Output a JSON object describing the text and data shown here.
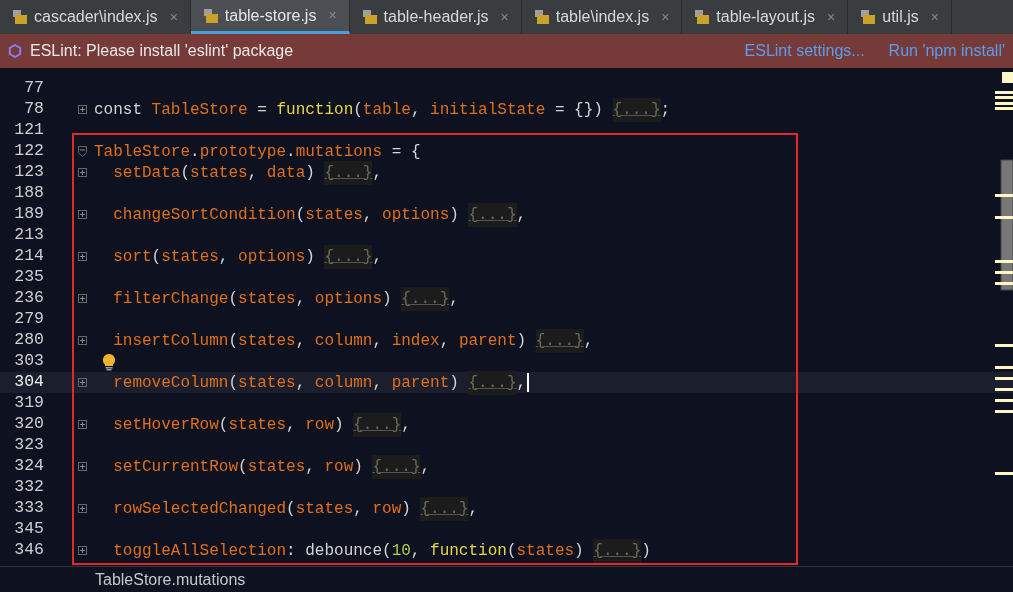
{
  "tabs": [
    {
      "label": "cascader\\index.js",
      "selected": false
    },
    {
      "label": "table-store.js",
      "selected": true
    },
    {
      "label": "table-header.js",
      "selected": false
    },
    {
      "label": "table\\index.js",
      "selected": false
    },
    {
      "label": "table-layout.js",
      "selected": false
    },
    {
      "label": "util.js",
      "selected": false
    }
  ],
  "tab_close": "×",
  "notification": {
    "message": "ESLint: Please install 'eslint' package",
    "actions": [
      "ESLint settings...",
      "Run 'npm install'"
    ]
  },
  "editor": {
    "lines": [
      {
        "number": "77",
        "kind": "none",
        "current": false
      },
      {
        "number": "78",
        "kind": "expand",
        "current": false,
        "tokens": [
          {
            "kind": "plain",
            "text": "const "
          },
          {
            "kind": "name",
            "text": "TableStore"
          },
          {
            "kind": "plain",
            "text": " = "
          },
          {
            "kind": "keyword",
            "text": "function"
          },
          {
            "kind": "plain",
            "text": "("
          },
          {
            "kind": "name",
            "text": "table"
          },
          {
            "kind": "plain",
            "text": ", "
          },
          {
            "kind": "name",
            "text": "initialState"
          },
          {
            "kind": "plain",
            "text": " = {}) "
          },
          {
            "kind": "folded",
            "text": "{...}"
          },
          {
            "kind": "plain",
            "text": ";"
          }
        ]
      },
      {
        "number": "121",
        "kind": "none",
        "current": false
      },
      {
        "number": "122",
        "kind": "collapse",
        "current": false,
        "tokens": [
          {
            "kind": "name",
            "text": "TableStore"
          },
          {
            "kind": "plain",
            "text": "."
          },
          {
            "kind": "name",
            "text": "prototype"
          },
          {
            "kind": "plain",
            "text": "."
          },
          {
            "kind": "name",
            "text": "mutations"
          },
          {
            "kind": "plain",
            "text": " = {"
          }
        ]
      },
      {
        "number": "123",
        "kind": "expand",
        "current": false,
        "tokens": [
          {
            "kind": "name",
            "text": "  setData"
          },
          {
            "kind": "plain",
            "text": "("
          },
          {
            "kind": "name",
            "text": "states"
          },
          {
            "kind": "plain",
            "text": ", "
          },
          {
            "kind": "name",
            "text": "data"
          },
          {
            "kind": "plain",
            "text": ") "
          },
          {
            "kind": "folded",
            "text": "{...}"
          },
          {
            "kind": "plain",
            "text": ","
          }
        ]
      },
      {
        "number": "188",
        "kind": "none",
        "current": false
      },
      {
        "number": "189",
        "kind": "expand",
        "current": false,
        "tokens": [
          {
            "kind": "name",
            "text": "  changeSortCondition"
          },
          {
            "kind": "plain",
            "text": "("
          },
          {
            "kind": "name",
            "text": "states"
          },
          {
            "kind": "plain",
            "text": ", "
          },
          {
            "kind": "name",
            "text": "options"
          },
          {
            "kind": "plain",
            "text": ") "
          },
          {
            "kind": "folded",
            "text": "{...}"
          },
          {
            "kind": "plain",
            "text": ","
          }
        ]
      },
      {
        "number": "213",
        "kind": "none",
        "current": false
      },
      {
        "number": "214",
        "kind": "expand",
        "current": false,
        "tokens": [
          {
            "kind": "name",
            "text": "  sort"
          },
          {
            "kind": "plain",
            "text": "("
          },
          {
            "kind": "name",
            "text": "states"
          },
          {
            "kind": "plain",
            "text": ", "
          },
          {
            "kind": "name",
            "text": "options"
          },
          {
            "kind": "plain",
            "text": ") "
          },
          {
            "kind": "folded",
            "text": "{...}"
          },
          {
            "kind": "plain",
            "text": ","
          }
        ]
      },
      {
        "number": "235",
        "kind": "none",
        "current": false
      },
      {
        "number": "236",
        "kind": "expand",
        "current": false,
        "tokens": [
          {
            "kind": "name",
            "text": "  filterChange"
          },
          {
            "kind": "plain",
            "text": "("
          },
          {
            "kind": "name",
            "text": "states"
          },
          {
            "kind": "plain",
            "text": ", "
          },
          {
            "kind": "name",
            "text": "options"
          },
          {
            "kind": "plain",
            "text": ") "
          },
          {
            "kind": "folded",
            "text": "{...}"
          },
          {
            "kind": "plain",
            "text": ","
          }
        ]
      },
      {
        "number": "279",
        "kind": "none",
        "current": false
      },
      {
        "number": "280",
        "kind": "expand",
        "current": false,
        "tokens": [
          {
            "kind": "name",
            "text": "  insertColumn"
          },
          {
            "kind": "plain",
            "text": "("
          },
          {
            "kind": "name",
            "text": "states"
          },
          {
            "kind": "plain",
            "text": ", "
          },
          {
            "kind": "name",
            "text": "column"
          },
          {
            "kind": "plain",
            "text": ", "
          },
          {
            "kind": "name",
            "text": "index"
          },
          {
            "kind": "plain",
            "text": ", "
          },
          {
            "kind": "name",
            "text": "parent"
          },
          {
            "kind": "plain",
            "text": ") "
          },
          {
            "kind": "folded",
            "text": "{...}"
          },
          {
            "kind": "plain",
            "text": ","
          }
        ]
      },
      {
        "number": "303",
        "kind": "none",
        "current": false,
        "bulb": true
      },
      {
        "number": "304",
        "kind": "expand",
        "current": true,
        "tokens": [
          {
            "kind": "name",
            "text": "  removeColumn"
          },
          {
            "kind": "plain",
            "text": "("
          },
          {
            "kind": "name",
            "text": "states"
          },
          {
            "kind": "plain",
            "text": ", "
          },
          {
            "kind": "name",
            "text": "column"
          },
          {
            "kind": "plain",
            "text": ", "
          },
          {
            "kind": "name",
            "text": "parent"
          },
          {
            "kind": "plain",
            "text": ") "
          },
          {
            "kind": "folded",
            "text": "{...}"
          },
          {
            "kind": "plain",
            "text": ","
          }
        ]
      },
      {
        "number": "319",
        "kind": "none",
        "current": false
      },
      {
        "number": "320",
        "kind": "expand",
        "current": false,
        "tokens": [
          {
            "kind": "name",
            "text": "  setHoverRow"
          },
          {
            "kind": "plain",
            "text": "("
          },
          {
            "kind": "name",
            "text": "states"
          },
          {
            "kind": "plain",
            "text": ", "
          },
          {
            "kind": "name",
            "text": "row"
          },
          {
            "kind": "plain",
            "text": ") "
          },
          {
            "kind": "folded",
            "text": "{...}"
          },
          {
            "kind": "plain",
            "text": ","
          }
        ]
      },
      {
        "number": "323",
        "kind": "none",
        "current": false
      },
      {
        "number": "324",
        "kind": "expand",
        "current": false,
        "tokens": [
          {
            "kind": "name",
            "text": "  setCurrentRow"
          },
          {
            "kind": "plain",
            "text": "("
          },
          {
            "kind": "name",
            "text": "states"
          },
          {
            "kind": "plain",
            "text": ", "
          },
          {
            "kind": "name",
            "text": "row"
          },
          {
            "kind": "plain",
            "text": ") "
          },
          {
            "kind": "folded",
            "text": "{...}"
          },
          {
            "kind": "plain",
            "text": ","
          }
        ]
      },
      {
        "number": "332",
        "kind": "none",
        "current": false
      },
      {
        "number": "333",
        "kind": "expand",
        "current": false,
        "tokens": [
          {
            "kind": "name",
            "text": "  rowSelectedChanged"
          },
          {
            "kind": "plain",
            "text": "("
          },
          {
            "kind": "name",
            "text": "states"
          },
          {
            "kind": "plain",
            "text": ", "
          },
          {
            "kind": "name",
            "text": "row"
          },
          {
            "kind": "plain",
            "text": ") "
          },
          {
            "kind": "folded",
            "text": "{...}"
          },
          {
            "kind": "plain",
            "text": ","
          }
        ]
      },
      {
        "number": "345",
        "kind": "none",
        "current": false
      },
      {
        "number": "346",
        "kind": "expand",
        "current": false,
        "tokens": [
          {
            "kind": "name",
            "text": "  toggleAllSelection"
          },
          {
            "kind": "plain",
            "text": ": debounce("
          },
          {
            "kind": "number",
            "text": "10"
          },
          {
            "kind": "plain",
            "text": ", "
          },
          {
            "kind": "keyword",
            "text": "function"
          },
          {
            "kind": "plain",
            "text": "("
          },
          {
            "kind": "name",
            "text": "states"
          },
          {
            "kind": "plain",
            "text": ") "
          },
          {
            "kind": "folded",
            "text": "{...}"
          },
          {
            "kind": "plain",
            "text": ")"
          }
        ]
      }
    ]
  },
  "breadcrumb": "TableStore.mutations"
}
